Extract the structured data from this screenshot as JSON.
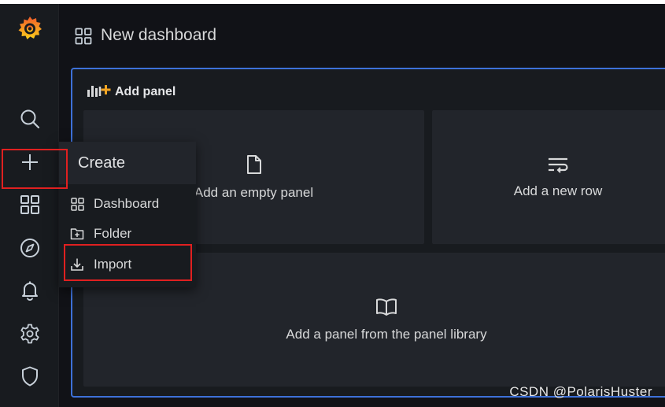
{
  "header": {
    "title": "New dashboard"
  },
  "sidebar": {
    "items": [
      {
        "name": "grafana-logo",
        "icon": "grafana-logo"
      },
      {
        "name": "search",
        "icon": "search-icon"
      },
      {
        "name": "create",
        "icon": "plus-icon"
      },
      {
        "name": "dashboards",
        "icon": "apps-icon"
      },
      {
        "name": "explore",
        "icon": "compass-icon"
      },
      {
        "name": "alerting",
        "icon": "bell-icon"
      },
      {
        "name": "configuration",
        "icon": "gear-icon"
      },
      {
        "name": "server-admin",
        "icon": "shield-icon"
      }
    ]
  },
  "create_menu": {
    "header": "Create",
    "items": [
      {
        "label": "Dashboard",
        "icon": "apps-icon"
      },
      {
        "label": "Folder",
        "icon": "folder-plus-icon"
      },
      {
        "label": "Import",
        "icon": "import-icon"
      }
    ]
  },
  "panel": {
    "title": "Add panel",
    "options": [
      {
        "label": "Add an empty panel",
        "icon": "file-blank-icon"
      },
      {
        "label": "Add a new row",
        "icon": "wrap-text-icon"
      },
      {
        "label": "Add a panel from the panel library",
        "icon": "book-open-icon"
      }
    ]
  },
  "watermark": "CSDN @PolarisHuster",
  "colors": {
    "background": "#111217",
    "sidebar": "#181b1f",
    "panel_border": "#3d71d9",
    "highlight": "#e02020",
    "logo_orange": "#f46800"
  }
}
